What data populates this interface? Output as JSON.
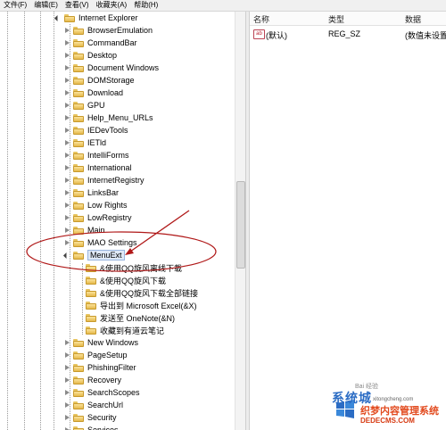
{
  "menubar": [
    "文件(F)",
    "编辑(E)",
    "查看(V)",
    "收藏夹(A)",
    "帮助(H)"
  ],
  "values_header": {
    "name": "名称",
    "type": "类型",
    "data": "数据"
  },
  "values_rows": [
    {
      "name": "(默认)",
      "type": "REG_SZ",
      "data": "(数值未设置)"
    }
  ],
  "tree": {
    "root": "Internet Explorer",
    "children": [
      "BrowserEmulation",
      "CommandBar",
      "Desktop",
      "Document Windows",
      "DOMStorage",
      "Download",
      "GPU",
      "Help_Menu_URLs",
      "IEDevTools",
      "IETld",
      "IntelliForms",
      "International",
      "InternetRegistry",
      "LinksBar",
      "Low Rights",
      "LowRegistry",
      "Main",
      "MAO Settings",
      "MenuExt"
    ],
    "menuext_children": [
      "&使用QQ旋风离线下载",
      "&使用QQ旋风下载",
      "&使用QQ旋风下载全部链接",
      "导出到 Microsoft Excel(&X)",
      "发送至 OneNote(&N)",
      "收藏到有道云笔记"
    ],
    "after": [
      "New Windows",
      "PageSetup",
      "PhishingFilter",
      "Recovery",
      "SearchScopes",
      "SearchUrl",
      "Security",
      "Services"
    ]
  },
  "watermark": {
    "brand": "系统城",
    "site": "织梦内容管理系统",
    "url": "DEDECMS.COM",
    "small": "xitongcheng.com",
    "baidu": "Bai 经验"
  },
  "colors": {
    "folder": "#e5b94b",
    "selection": "#dfe9f7",
    "annotation": "#b01818",
    "watermark_blue": "#2b6cc4",
    "watermark_red": "#e24a1e"
  }
}
